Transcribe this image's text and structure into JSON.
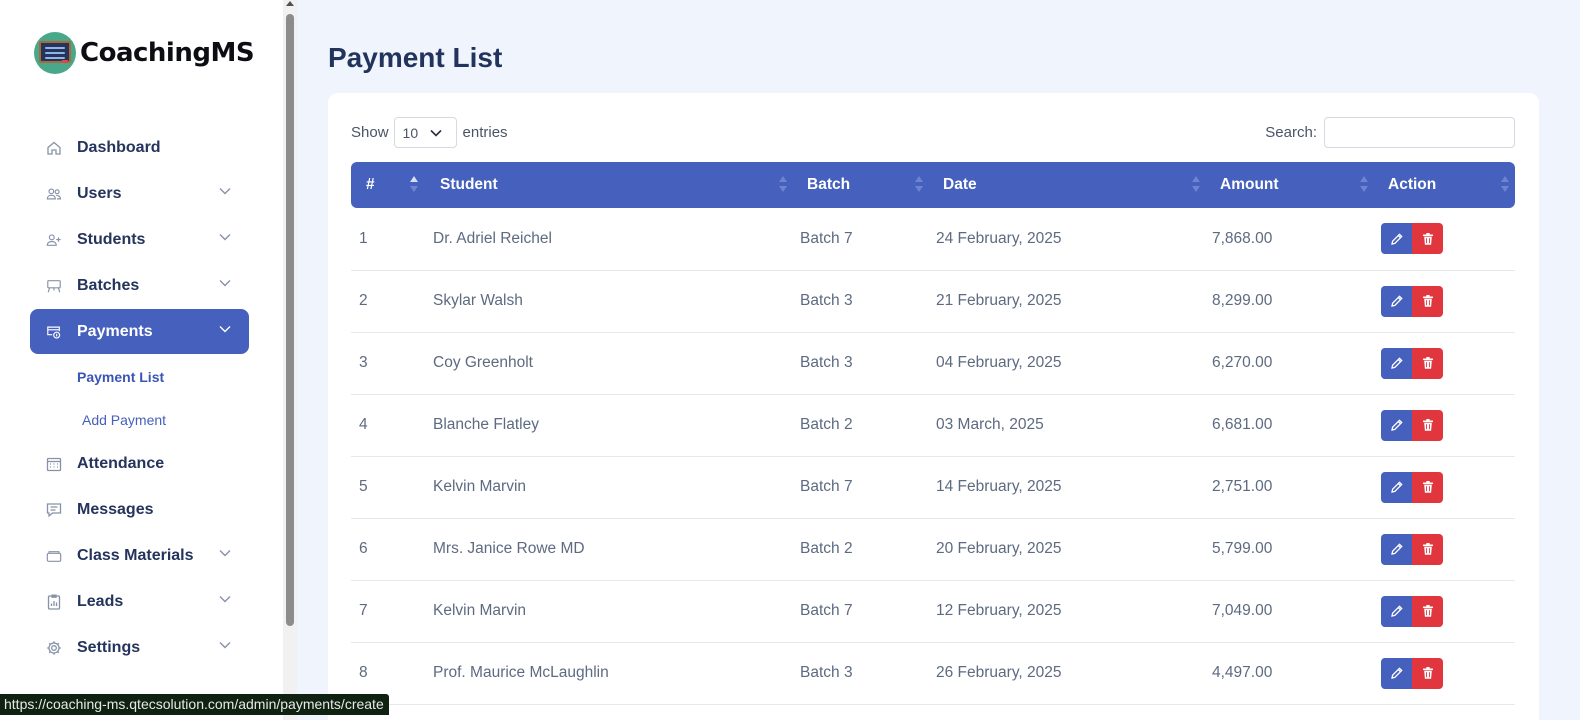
{
  "brand": {
    "name": "CoachingMS"
  },
  "sidebar": {
    "items": [
      {
        "label": "Dashboard",
        "icon": "home-icon",
        "has_children": false
      },
      {
        "label": "Users",
        "icon": "users-icon",
        "has_children": true
      },
      {
        "label": "Students",
        "icon": "user-plus-icon",
        "has_children": true
      },
      {
        "label": "Batches",
        "icon": "easel-icon",
        "has_children": true
      },
      {
        "label": "Payments",
        "icon": "payment-icon",
        "has_children": true,
        "active": true
      },
      {
        "label": "Attendance",
        "icon": "calendar-icon",
        "has_children": false
      },
      {
        "label": "Messages",
        "icon": "message-icon",
        "has_children": false
      },
      {
        "label": "Class Materials",
        "icon": "folder-icon",
        "has_children": true
      },
      {
        "label": "Leads",
        "icon": "report-icon",
        "has_children": true
      },
      {
        "label": "Settings",
        "icon": "gear-icon",
        "has_children": true
      }
    ],
    "payments_sub": [
      {
        "label": "Payment List",
        "current": true
      },
      {
        "label": "Add Payment",
        "current": false
      }
    ]
  },
  "main": {
    "title": "Payment List",
    "show_label": "Show",
    "entries_value": "10",
    "entries_label": "entries",
    "search_label": "Search:",
    "search_value": ""
  },
  "table": {
    "columns": [
      "#",
      "Student",
      "Batch",
      "Date",
      "Amount",
      "Action"
    ],
    "rows": [
      {
        "num": "1",
        "student": "Dr. Adriel Reichel",
        "batch": "Batch 7",
        "date": "24 February, 2025",
        "amount": "7,868.00"
      },
      {
        "num": "2",
        "student": "Skylar Walsh",
        "batch": "Batch 3",
        "date": "21 February, 2025",
        "amount": "8,299.00"
      },
      {
        "num": "3",
        "student": "Coy Greenholt",
        "batch": "Batch 3",
        "date": "04 February, 2025",
        "amount": "6,270.00"
      },
      {
        "num": "4",
        "student": "Blanche Flatley",
        "batch": "Batch 2",
        "date": "03 March, 2025",
        "amount": "6,681.00"
      },
      {
        "num": "5",
        "student": "Kelvin Marvin",
        "batch": "Batch 7",
        "date": "14 February, 2025",
        "amount": "2,751.00"
      },
      {
        "num": "6",
        "student": "Mrs. Janice Rowe MD",
        "batch": "Batch 2",
        "date": "20 February, 2025",
        "amount": "5,799.00"
      },
      {
        "num": "7",
        "student": "Kelvin Marvin",
        "batch": "Batch 7",
        "date": "12 February, 2025",
        "amount": "7,049.00"
      },
      {
        "num": "8",
        "student": "Prof. Maurice McLaughlin",
        "batch": "Batch 3",
        "date": "26 February, 2025",
        "amount": "4,497.00"
      }
    ]
  },
  "status_bar": {
    "url": "https://coaching-ms.qtecsolution.com/admin/payments/create"
  },
  "colors": {
    "primary": "#4560bd",
    "danger": "#e2363f",
    "background": "#f0f5fd",
    "title": "#22345e"
  }
}
